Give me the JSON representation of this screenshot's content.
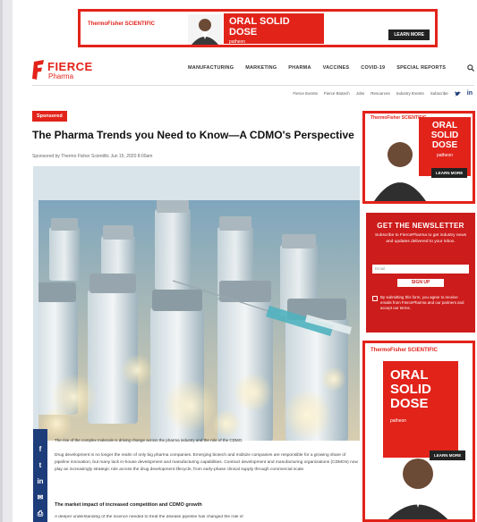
{
  "top_ad": {
    "brand": "ThermoFisher SCIENTIFIC",
    "headline": "ORAL SOLID DOSE",
    "sub": "patheon",
    "cta": "LEARN MORE"
  },
  "header": {
    "logo_main": "FIERCE",
    "logo_sub": "Pharma",
    "nav": [
      "MANUFACTURING",
      "MARKETING",
      "PHARMA",
      "VACCINES",
      "COVID-19",
      "SPECIAL REPORTS"
    ],
    "subnav": [
      "Fierce Events",
      "Fierce Biotech",
      "Jobs",
      "Resources",
      "Industry Events",
      "Subscribe"
    ]
  },
  "article": {
    "badge": "Sponsored",
    "title": "The Pharma Trends you Need to Know—A CDMO's Perspective",
    "byline": "Sponsored by Thermo Fisher Scientific  Jun 15, 2020 8:00am",
    "caption": "The rise of the complex molecule is driving change across the pharma industry and the role of the CDMO.",
    "paragraph1": "Drug development is no longer the realm of only big pharma companies. Emerging biotech and midsize companies are responsible for a growing share of pipeline innovation, but many lack in-house development and manufacturing capabilities. Contract development and manufacturing organizations (CDMOs) now play an increasingly strategic role across the drug development lifecycle, from early-phase clinical supply through commercial scale.",
    "heading": "The market impact of increased competition and CDMO growth",
    "paragraph2": "A deeper understanding of the science needed to treat the disease pipeline has changed the role of"
  },
  "share_icons": [
    "f",
    "t",
    "in",
    "✉",
    "⎙"
  ],
  "sidebar_ad1": {
    "brand": "ThermoFisher SCIENTIFIC",
    "headline": "ORAL SOLID DOSE",
    "sub": "patheon",
    "cta": "LEARN MORE"
  },
  "newsletter": {
    "heading": "GET THE NEWSLETTER",
    "desc": "Subscribe to FiercePharma to get industry news and updates delivered to your inbox.",
    "placeholder": "Email",
    "button": "SIGN UP",
    "consent": "By submitting this form, you agree to receive emails from FiercePharma and our partners and accept our terms."
  },
  "sidebar_ad2": {
    "brand": "ThermoFisher SCIENTIFIC",
    "headline": "ORAL SOLID DOSE",
    "sub": "patheon",
    "cta": "LEARN MORE"
  }
}
